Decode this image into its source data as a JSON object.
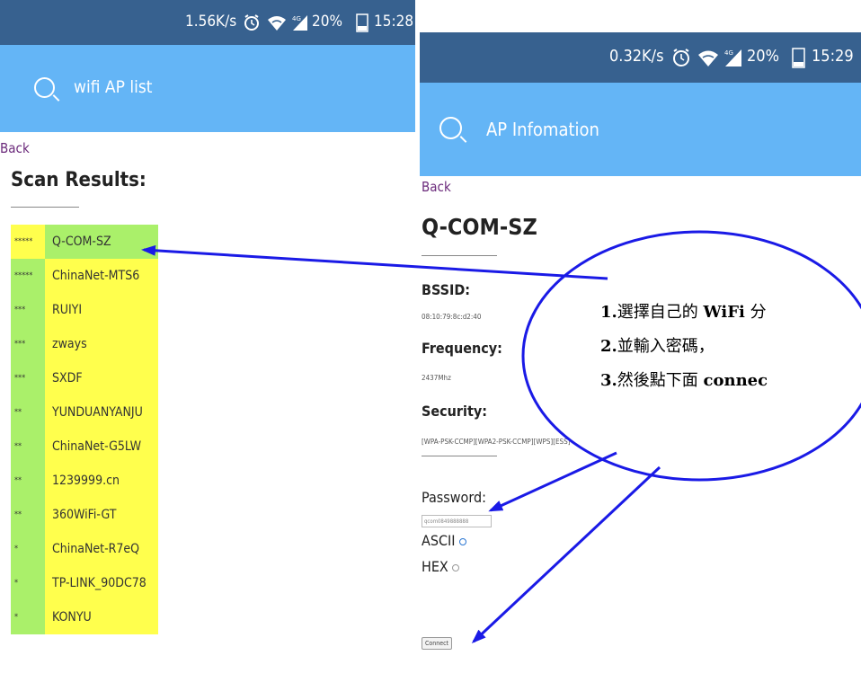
{
  "left_screen": {
    "status": {
      "speed": "1.56K/s",
      "battery": "20%",
      "time": "15:28"
    },
    "search_title": "wifi AP list",
    "back_label": "Back",
    "heading": "Scan Results:",
    "aps": [
      {
        "stars": "*****",
        "ssid": "Q-COM-SZ"
      },
      {
        "stars": "*****",
        "ssid": "ChinaNet-MTS6"
      },
      {
        "stars": "***",
        "ssid": "RUIYI"
      },
      {
        "stars": "***",
        "ssid": "zways"
      },
      {
        "stars": "***",
        "ssid": "SXDF"
      },
      {
        "stars": "**",
        "ssid": "YUNDUANYANJU"
      },
      {
        "stars": "**",
        "ssid": "ChinaNet-G5LW"
      },
      {
        "stars": "**",
        "ssid": "1239999.cn"
      },
      {
        "stars": "**",
        "ssid": "360WiFi-GT"
      },
      {
        "stars": "*",
        "ssid": "ChinaNet-R7eQ"
      },
      {
        "stars": "*",
        "ssid": "TP-LINK_90DC78"
      },
      {
        "stars": "*",
        "ssid": "KONYU"
      }
    ]
  },
  "right_screen": {
    "status": {
      "speed": "0.32K/s",
      "battery": "20%",
      "time": "15:29"
    },
    "search_title": "AP Infomation",
    "back_label": "Back",
    "ap_name": "Q-COM-SZ",
    "bssid_label": "BSSID:",
    "bssid_value": "08:10:79:8c:d2:40",
    "frequency_label": "Frequency:",
    "frequency_value": "2437Mhz",
    "security_label": "Security:",
    "security_value": "[WPA-PSK-CCMP][WPA2-PSK-CCMP][WPS][ESS]",
    "password_label": "Password:",
    "password_value": "qcom0849888888",
    "ascii_label": "ASCII",
    "hex_label": "HEX",
    "connect_label": "Connect"
  },
  "annotation": {
    "line1_num": "1.",
    "line1_a": "選擇自己的 ",
    "line1_b": "WiFi",
    "line1_c": " 分",
    "line2_num": "2.",
    "line2_text": "並輸入密碼，",
    "line3_num": "3.",
    "line3_a": "然後點下面 ",
    "line3_b": "connec",
    "accent": "#1a1ae6"
  }
}
